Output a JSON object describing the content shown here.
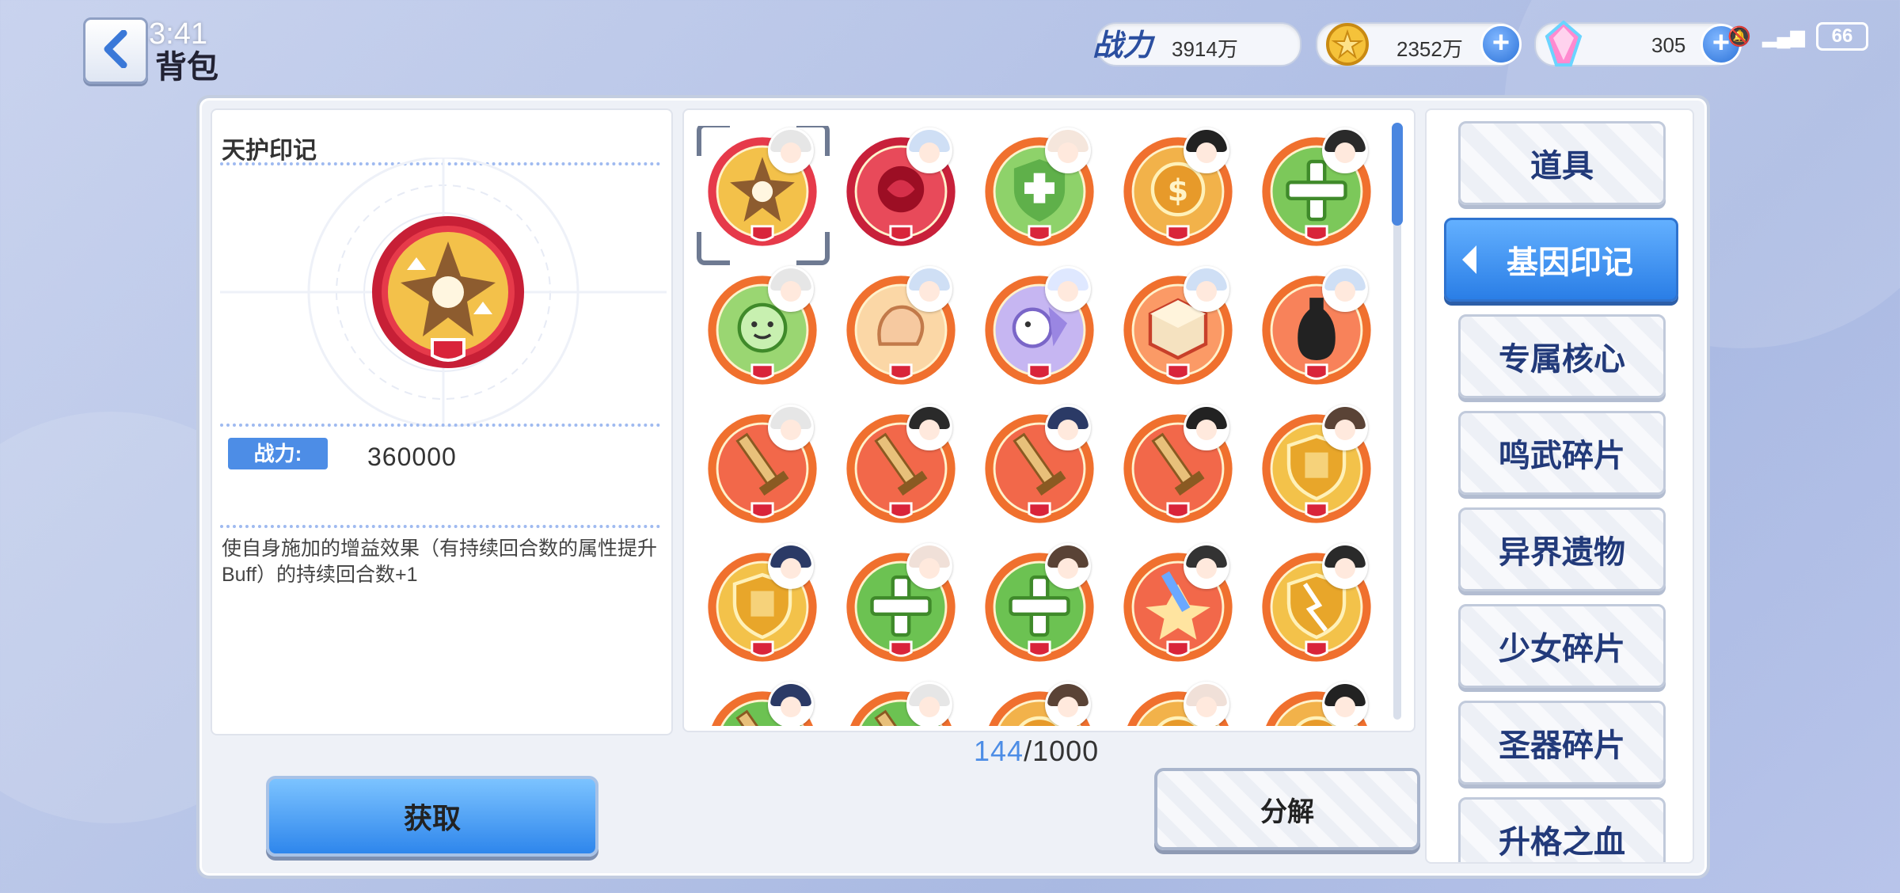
{
  "status_bar": {
    "time": "3:41",
    "battery": "66"
  },
  "header": {
    "title": "背包",
    "power_value": "3914万",
    "gold_value": "2352万",
    "gem_value": "305"
  },
  "detail": {
    "item_name": "天护印记",
    "power_label": "战力:",
    "power_value": "360000",
    "description": "使自身施加的增益效果（有持续回合数的属性提升Buff）的持续回合数+1"
  },
  "inventory": {
    "count_current": "144",
    "count_max": "/1000"
  },
  "buttons": {
    "get": "获取",
    "decompose": "分解"
  },
  "categories": [
    {
      "label": "道具",
      "active": false
    },
    {
      "label": "基因印记",
      "active": true
    },
    {
      "label": "专属核心",
      "active": false
    },
    {
      "label": "鸣武碎片",
      "active": false
    },
    {
      "label": "异界遗物",
      "active": false
    },
    {
      "label": "少女碎片",
      "active": false
    },
    {
      "label": "圣器碎片",
      "active": false
    },
    {
      "label": "升格之血",
      "active": false
    }
  ],
  "grid_items": [
    {
      "icon": "sparkle-flower-icon",
      "ring": "#e63a4a",
      "fill": "#f3c14a",
      "hair": "#e6e6e6"
    },
    {
      "icon": "rose-icon",
      "ring": "#c8203a",
      "fill": "#e84a5a",
      "hair": "#cfdff5"
    },
    {
      "icon": "shield-cross-icon",
      "ring": "#f0702e",
      "fill": "#8ed26a",
      "hair": "#f5e6dc"
    },
    {
      "icon": "gold-emblem-icon",
      "ring": "#f0702e",
      "fill": "#f2b24a",
      "hair": "#222222"
    },
    {
      "icon": "green-cross-icon",
      "ring": "#f0702e",
      "fill": "#7cc85a",
      "hair": "#2a2a2a"
    },
    {
      "icon": "smile-spirit-icon",
      "ring": "#f0702e",
      "fill": "#9ad672",
      "hair": "#e6e6e6"
    },
    {
      "icon": "fist-icon",
      "ring": "#f0702e",
      "fill": "#fbd7a6",
      "hair": "#cfdff5"
    },
    {
      "icon": "ghost-spirit-icon",
      "ring": "#f0702e",
      "fill": "#c6b6f2",
      "hair": "#dfe8ff"
    },
    {
      "icon": "cube-icon",
      "ring": "#f0702e",
      "fill": "#fb9a66",
      "hair": "#cfdff5"
    },
    {
      "icon": "vase-icon",
      "ring": "#f0702e",
      "fill": "#f8825a",
      "hair": "#cfdff5"
    },
    {
      "icon": "sword-icon",
      "ring": "#f0702e",
      "fill": "#f2684a",
      "hair": "#e6e6e6"
    },
    {
      "icon": "sword-icon",
      "ring": "#f0702e",
      "fill": "#f2684a",
      "hair": "#2a2a2a"
    },
    {
      "icon": "sword-icon",
      "ring": "#f0702e",
      "fill": "#f2684a",
      "hair": "#2b3a66"
    },
    {
      "icon": "sword-icon",
      "ring": "#f0702e",
      "fill": "#f2684a",
      "hair": "#222222"
    },
    {
      "icon": "gold-shield-icon",
      "ring": "#f0702e",
      "fill": "#f3c24a",
      "hair": "#5a4336"
    },
    {
      "icon": "gold-shield-icon",
      "ring": "#f0702e",
      "fill": "#f3c24a",
      "hair": "#2b3a66"
    },
    {
      "icon": "green-cross-icon",
      "ring": "#f0702e",
      "fill": "#6cc252",
      "hair": "#f0e0d8"
    },
    {
      "icon": "green-cross-icon",
      "ring": "#f0702e",
      "fill": "#6cc252",
      "hair": "#5a4336"
    },
    {
      "icon": "dagger-burst-icon",
      "ring": "#f0702e",
      "fill": "#f2684a",
      "hair": "#333333"
    },
    {
      "icon": "gold-shield-break-icon",
      "ring": "#f0702e",
      "fill": "#f3c24a",
      "hair": "#2a2a2a"
    },
    {
      "icon": "sword-icon",
      "ring": "#f0702e",
      "fill": "#6cc252",
      "hair": "#2b3a66"
    },
    {
      "icon": "sword-icon",
      "ring": "#f0702e",
      "fill": "#6cc252",
      "hair": "#e6e6e6"
    },
    {
      "icon": "gold-emblem-icon",
      "ring": "#f0702e",
      "fill": "#f2b24a",
      "hair": "#5a4336"
    },
    {
      "icon": "gold-emblem-icon",
      "ring": "#f0702e",
      "fill": "#f2b24a",
      "hair": "#f0e0d8"
    },
    {
      "icon": "gold-emblem-icon",
      "ring": "#f0702e",
      "fill": "#f2b24a",
      "hair": "#222222"
    }
  ]
}
